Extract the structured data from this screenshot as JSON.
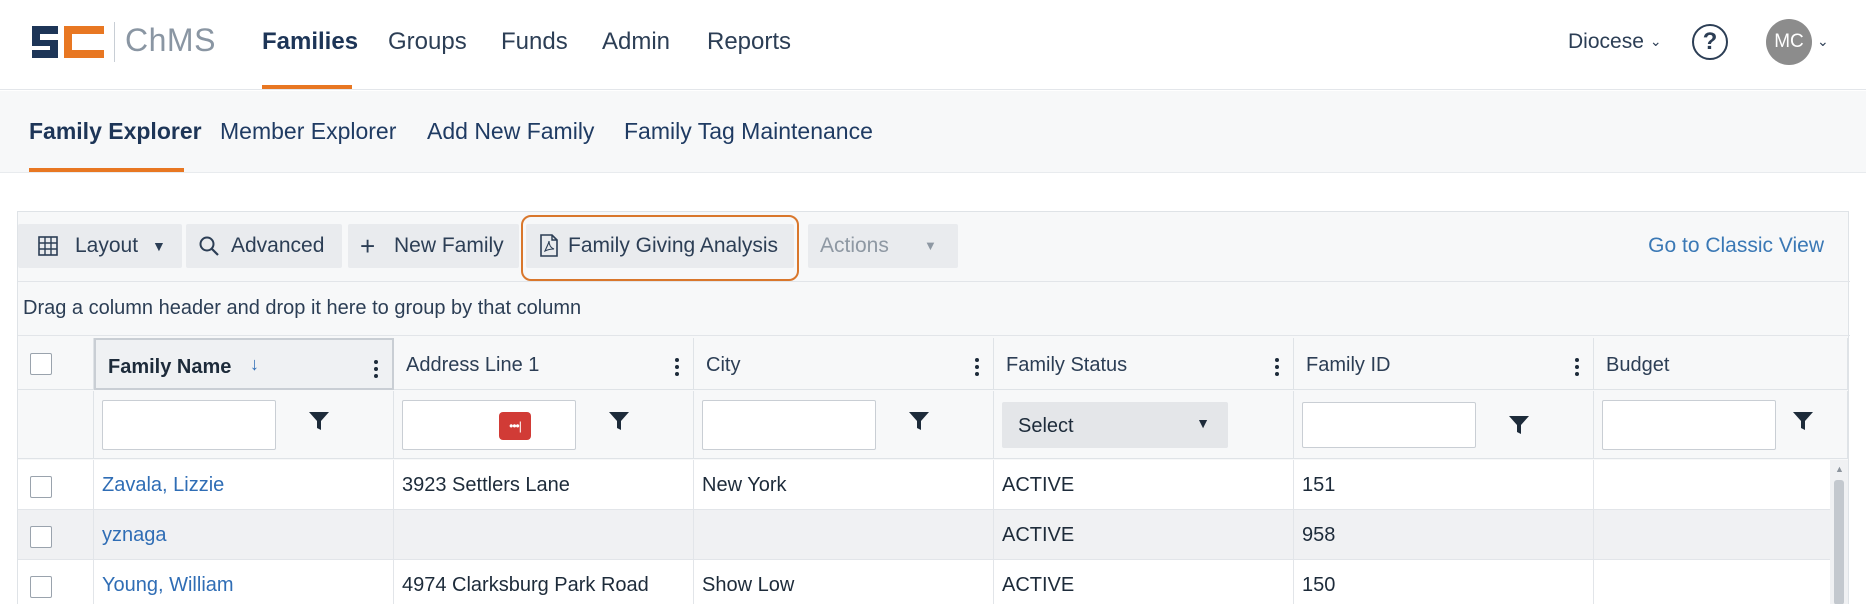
{
  "app": {
    "logo_text": "ChMS",
    "brand_colors": {
      "navy": "#1d3557",
      "orange": "#e87722"
    }
  },
  "nav": {
    "items": [
      {
        "label": "Families",
        "active": true
      },
      {
        "label": "Groups",
        "active": false
      },
      {
        "label": "Funds",
        "active": false
      },
      {
        "label": "Admin",
        "active": false
      },
      {
        "label": "Reports",
        "active": false
      }
    ],
    "diocese_label": "Diocese",
    "help_glyph": "?",
    "avatar_initials": "MC"
  },
  "subnav": {
    "items": [
      {
        "label": "Family Explorer",
        "active": true
      },
      {
        "label": "Member Explorer",
        "active": false
      },
      {
        "label": "Add New Family",
        "active": false
      },
      {
        "label": "Family Tag Maintenance",
        "active": false
      }
    ]
  },
  "toolbar": {
    "layout_label": "Layout",
    "advanced_label": "Advanced",
    "new_family_label": "New Family",
    "giving_analysis_label": "Family Giving Analysis",
    "actions_label": "Actions",
    "classic_view_label": "Go to Classic View"
  },
  "grid": {
    "group_hint": "Drag a column header and drop it here to group by that column",
    "columns": [
      {
        "label": "Family Name",
        "sorted": "descending"
      },
      {
        "label": "Address Line 1"
      },
      {
        "label": "City"
      },
      {
        "label": "Family Status"
      },
      {
        "label": "Family ID"
      },
      {
        "label": "Budget"
      }
    ],
    "status_filter_placeholder": "Select",
    "rows": [
      {
        "name": "Zavala, Lizzie",
        "address": "3923 Settlers Lane",
        "city": "New York",
        "status": "ACTIVE",
        "id": "151",
        "budget": ""
      },
      {
        "name": "yznaga",
        "address": "",
        "city": "",
        "status": "ACTIVE",
        "id": "958",
        "budget": ""
      },
      {
        "name": "Young, William",
        "address": "4974 Clarksburg Park Road",
        "city": "Show Low",
        "status": "ACTIVE",
        "id": "150",
        "budget": ""
      }
    ]
  }
}
